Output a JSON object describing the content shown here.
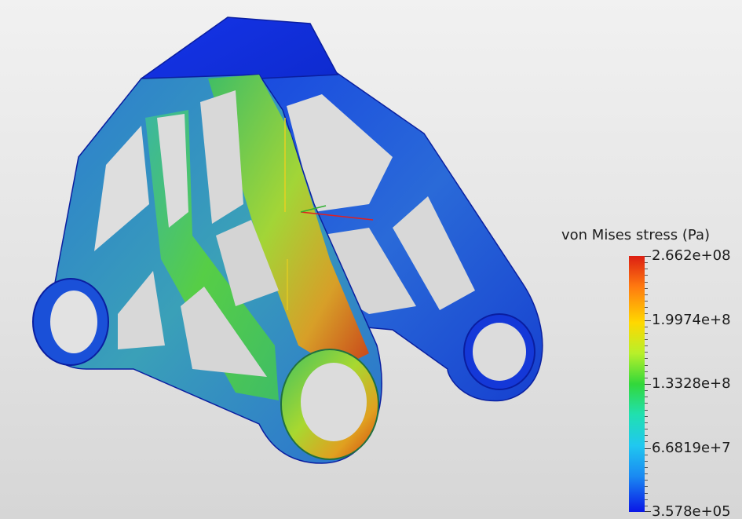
{
  "legend": {
    "title": "von Mises stress (Pa)",
    "labels": [
      "2.662e+08",
      "1.9974e+8",
      "1.3328e+8",
      "6.6819e+7",
      "3.578e+05"
    ],
    "colors": {
      "max": "#dc1e12",
      "high": "#ffd800",
      "mid": "#32d83a",
      "low": "#20c8f0",
      "min": "#0a16e6"
    }
  },
  "axes_triad": {
    "x_color": "#e02020",
    "y_color": "#e8d020",
    "z_color": "#30b030"
  }
}
